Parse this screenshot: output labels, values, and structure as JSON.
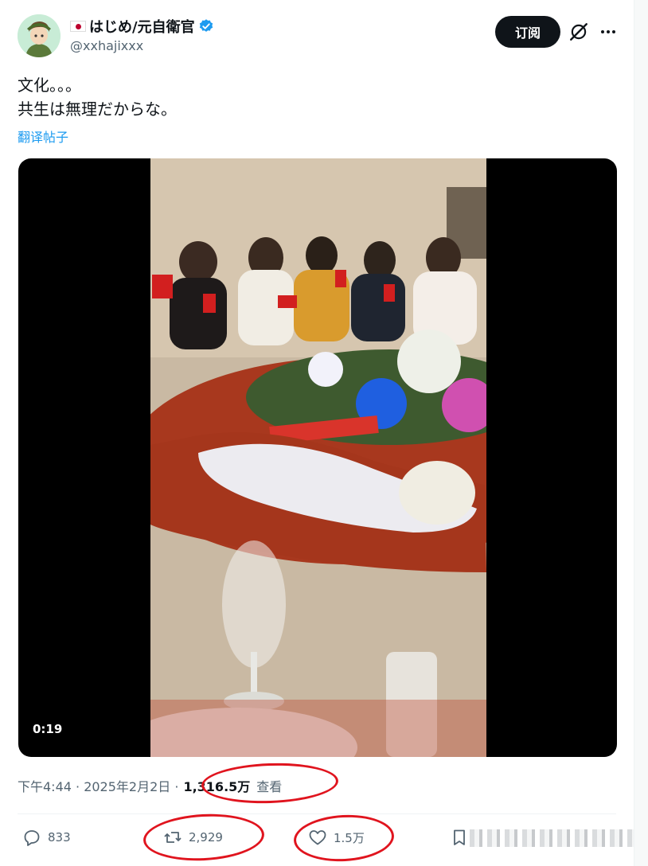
{
  "author": {
    "display_name": "はじめ/元自衛官",
    "handle": "@xxhajixxx",
    "flag_icon": "japan-flag-icon",
    "verified_color": "#1d9bf0"
  },
  "header": {
    "subscribe_label": "订阅",
    "grok_icon": "grok-icon",
    "more_icon": "more-icon"
  },
  "post": {
    "lines": [
      "文化。。。",
      "共生は無理だからな。"
    ],
    "translate_label": "翻译帖子"
  },
  "video": {
    "timestamp": "0:19"
  },
  "meta": {
    "time_date": "下午4:44 · 2025年2月2日 ·",
    "views_count": "1,316.5万",
    "views_label": "查看"
  },
  "actions": {
    "replies": "833",
    "retweets": "2,929",
    "likes": "1.5万"
  },
  "colors": {
    "accent": "#1d9bf0",
    "text": "#0f1419",
    "muted": "#536471",
    "annotation": "#e0141e"
  }
}
